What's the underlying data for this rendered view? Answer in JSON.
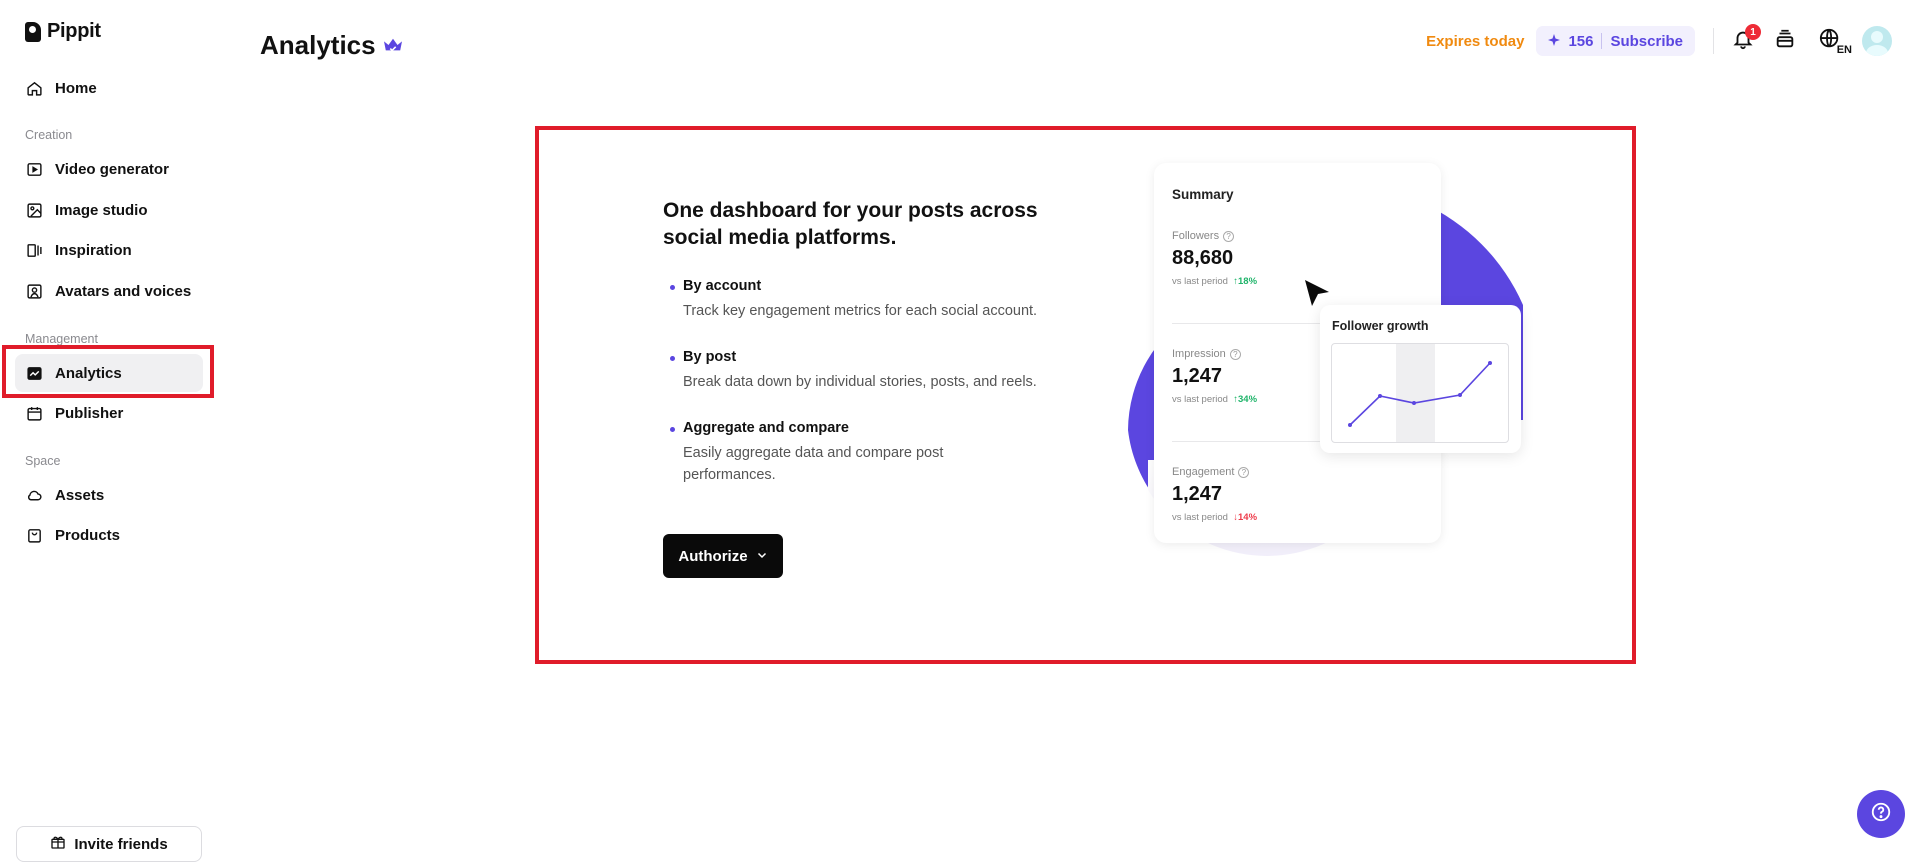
{
  "app": {
    "logo_text": "Pippit"
  },
  "sidebar": {
    "home": "Home",
    "sections": {
      "creation": "Creation",
      "management": "Management",
      "space": "Space"
    },
    "items": {
      "video_generator": "Video generator",
      "image_studio": "Image studio",
      "inspiration": "Inspiration",
      "avatars_voices": "Avatars and voices",
      "analytics": "Analytics",
      "publisher": "Publisher",
      "assets": "Assets",
      "products": "Products"
    },
    "invite": "Invite friends"
  },
  "header": {
    "title": "Analytics",
    "expires": "Expires today",
    "credits": "156",
    "subscribe": "Subscribe",
    "notification_count": "1",
    "language": "EN"
  },
  "main": {
    "headline": "One dashboard for your posts across social media platforms.",
    "features": [
      {
        "title": "By account",
        "desc": "Track key engagement metrics for each social account."
      },
      {
        "title": "By post",
        "desc": "Break data down by individual stories, posts, and reels."
      },
      {
        "title": "Aggregate and compare",
        "desc": "Easily aggregate data and compare post performances."
      }
    ],
    "authorize": "Authorize"
  },
  "illustration": {
    "summary_title": "Summary",
    "metrics": [
      {
        "label": "Followers",
        "value": "88,680",
        "compare": "vs last period",
        "change": "18%",
        "direction": "up"
      },
      {
        "label": "Impression",
        "value": "1,247",
        "compare": "vs last period",
        "change": "34%",
        "direction": "up"
      },
      {
        "label": "Engagement",
        "value": "1,247",
        "compare": "vs last period",
        "change": "14%",
        "direction": "down"
      }
    ],
    "growth_title": "Follower growth"
  },
  "colors": {
    "accent": "#5b46e0",
    "highlight": "#e01c2a",
    "expires": "#f08a10",
    "positive": "#1fb46a",
    "negative": "#ee3b4a"
  }
}
